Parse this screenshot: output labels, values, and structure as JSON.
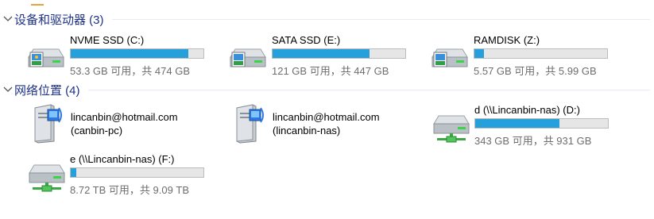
{
  "groups": {
    "devices": {
      "label": "设备和驱动器 (3)"
    },
    "network": {
      "label": "网络位置 (4)"
    }
  },
  "drives": [
    {
      "name": "NVME SSD (C:)",
      "space": "53.3 GB 可用，共 474 GB",
      "used_fraction": 0.887,
      "icon": "system-drive-icon"
    },
    {
      "name": "SATA SSD (E:)",
      "space": "121 GB 可用，共 447 GB",
      "used_fraction": 0.729,
      "icon": "drive-icon"
    },
    {
      "name": "RAMDISK (Z:)",
      "space": "5.57 GB 可用，共 5.99 GB",
      "used_fraction": 0.07,
      "icon": "drive-icon"
    }
  ],
  "network": [
    {
      "name": "lincanbin@hotmail.com",
      "host": "(canbin-pc)",
      "icon": "network-computer-icon"
    },
    {
      "name": "lincanbin@hotmail.com",
      "host": "(lincanbin-nas)",
      "icon": "network-computer-icon"
    },
    {
      "name": "d (\\\\Lincanbin-nas) (D:)",
      "space": "343 GB 可用，共 931 GB",
      "used_fraction": 0.632,
      "icon": "network-drive-icon"
    },
    {
      "name": "e (\\\\Lincanbin-nas) (F:)",
      "space": "8.72 TB 可用，共 9.09 TB",
      "used_fraction": 0.041,
      "icon": "network-drive-icon"
    }
  ],
  "colors": {
    "bar_fill": "#26a0da",
    "bar_track": "#e6e6e6",
    "header": "#1e3287"
  }
}
